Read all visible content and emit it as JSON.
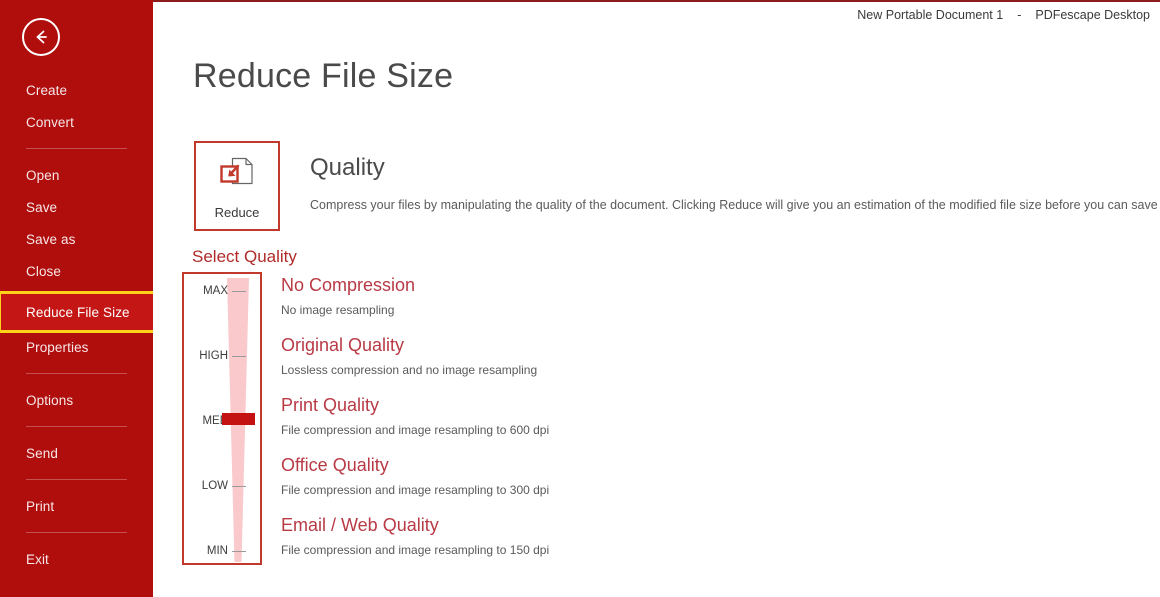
{
  "window": {
    "document_name": "New Portable Document 1",
    "separator": "-",
    "app_name": "PDFescape Desktop"
  },
  "sidebar": {
    "back_icon": "back-arrow-icon",
    "items": [
      {
        "label": "Create",
        "type": "item"
      },
      {
        "label": "Convert",
        "type": "item"
      },
      {
        "label": "",
        "type": "separator"
      },
      {
        "label": "Open",
        "type": "item"
      },
      {
        "label": "Save",
        "type": "item"
      },
      {
        "label": "Save as",
        "type": "item"
      },
      {
        "label": "Close",
        "type": "item"
      },
      {
        "label": "Reduce File Size",
        "type": "item",
        "selected": true
      },
      {
        "label": "Properties",
        "type": "item"
      },
      {
        "label": "",
        "type": "separator"
      },
      {
        "label": "Options",
        "type": "item"
      },
      {
        "label": "",
        "type": "separator"
      },
      {
        "label": "Send",
        "type": "item"
      },
      {
        "label": "",
        "type": "separator"
      },
      {
        "label": "Print",
        "type": "item"
      },
      {
        "label": "",
        "type": "separator"
      },
      {
        "label": "Exit",
        "type": "item"
      }
    ]
  },
  "main": {
    "page_title": "Reduce File Size",
    "reduce_button": {
      "label": "Reduce",
      "icon": "reduce-document-icon"
    },
    "quality": {
      "heading": "Quality",
      "description": "Compress your files by manipulating the quality of the document. Clicking Reduce will give you an estimation of the modified file size before you can save or discard it."
    },
    "select_quality_label": "Select Quality",
    "slider": {
      "ticks": [
        "MAX",
        "HIGH",
        "MED",
        "LOW",
        "MIN"
      ],
      "current_value": "MED"
    },
    "options": [
      {
        "title": "No Compression",
        "description": "No image resampling"
      },
      {
        "title": "Original Quality",
        "description": "Lossless compression and no image resampling"
      },
      {
        "title": "Print Quality",
        "description": "File compression and image resampling to 600 dpi"
      },
      {
        "title": "Office Quality",
        "description": "File compression and image resampling to 300 dpi"
      },
      {
        "title": "Email / Web Quality",
        "description": "File compression and image resampling to 150 dpi"
      }
    ]
  },
  "colors": {
    "sidebar_red": "#b00d0d",
    "selected_red": "#c51616",
    "highlight_yellow": "#ffd21a",
    "accent_red": "#c0392b",
    "option_title_red": "#b83a45",
    "wedge_pink": "#f9c9cc",
    "thumb_red": "#c41111"
  }
}
